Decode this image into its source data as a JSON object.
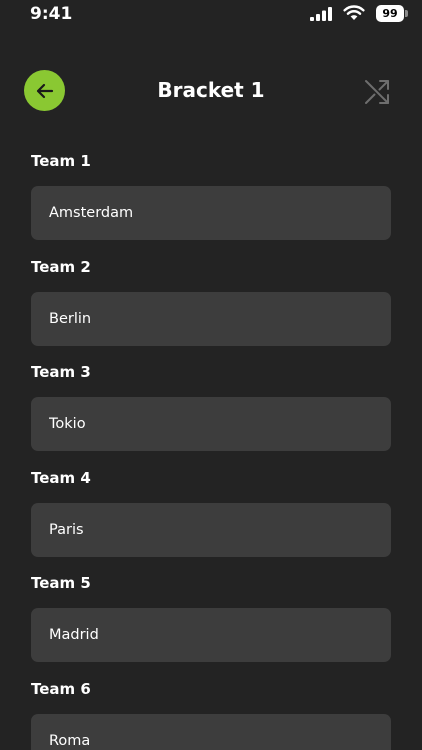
{
  "status_bar": {
    "time": "9:41",
    "battery": "99"
  },
  "header": {
    "title": "Bracket 1",
    "back_icon": "arrow-left-icon",
    "shuffle_icon": "shuffle-icon"
  },
  "colors": {
    "background": "#232323",
    "field": "#3d3d3d",
    "accent": "#8ac832"
  },
  "teams": [
    {
      "label": "Team 1",
      "value": "Amsterdam"
    },
    {
      "label": "Team 2",
      "value": "Berlin"
    },
    {
      "label": "Team 3",
      "value": "Tokio"
    },
    {
      "label": "Team 4",
      "value": "Paris"
    },
    {
      "label": "Team 5",
      "value": "Madrid"
    },
    {
      "label": "Team 6",
      "value": "Roma"
    }
  ]
}
